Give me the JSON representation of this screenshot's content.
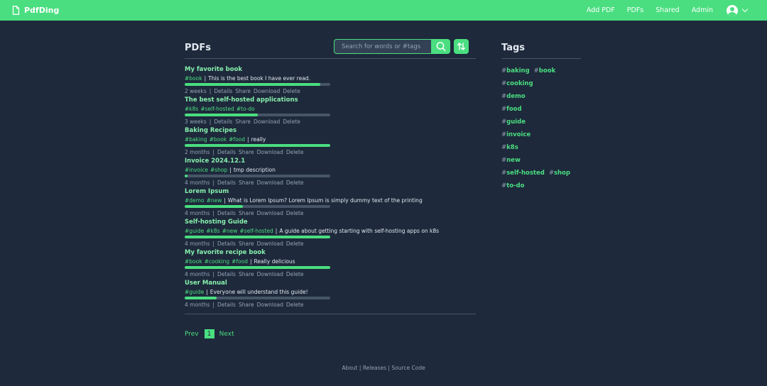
{
  "brand": {
    "name": "PdfDing"
  },
  "nav": {
    "add_pdf": "Add PDF",
    "pdfs": "PDFs",
    "shared": "Shared",
    "admin": "Admin"
  },
  "main": {
    "title": "PDFs",
    "search_placeholder": "Search for words or #tags"
  },
  "pdfs": [
    {
      "title": "My favorite book",
      "tags": [
        "#book"
      ],
      "description": "This is the best book I have ever read.",
      "progress": 0.93,
      "age": "2 weeks"
    },
    {
      "title": "The best self-hosted applications",
      "tags": [
        "#k8s",
        "#self-hosted",
        "#to-do"
      ],
      "description": "",
      "progress": 0.5,
      "age": "3 weeks"
    },
    {
      "title": "Baking Recipes",
      "tags": [
        "#baking",
        "#book",
        "#food"
      ],
      "description": "really",
      "progress": 1.0,
      "age": "2 months"
    },
    {
      "title": "Invoice 2024.12.1",
      "tags": [
        "#invoice",
        "#shop"
      ],
      "description": "tmp description",
      "progress": 0.02,
      "age": "4 months"
    },
    {
      "title": "Lorem Ipsum",
      "tags": [
        "#demo",
        "#new"
      ],
      "description": "What is Lorem Ipsum? Lorem Ipsum is simply dummy text of the printing",
      "progress": 0.4,
      "age": "4 months"
    },
    {
      "title": "Self-hosting Guide",
      "tags": [
        "#guide",
        "#k8s",
        "#new",
        "#self-hosted"
      ],
      "description": "A guide about getting starting with self-hosting apps on k8s",
      "progress": 1.0,
      "age": "4 months"
    },
    {
      "title": "My favorite recipe book",
      "tags": [
        "#book",
        "#cooking",
        "#food"
      ],
      "description": "Really delicious",
      "progress": 1.0,
      "age": "4 months"
    },
    {
      "title": "User Manual",
      "tags": [
        "#guide"
      ],
      "description": "Everyone will understand this guide!",
      "progress": 0.22,
      "age": "4 months"
    }
  ],
  "actions": {
    "details": "Details",
    "share": "Share",
    "download": "Download",
    "delete": "Delete"
  },
  "pagination": {
    "prev": "Prev",
    "current": "1",
    "next": "Next"
  },
  "sidebar": {
    "title": "Tags",
    "rows": [
      [
        "baking",
        "book"
      ],
      [
        "cooking"
      ],
      [
        "demo"
      ],
      [
        "food"
      ],
      [
        "guide"
      ],
      [
        "invoice"
      ],
      [
        "k8s"
      ],
      [
        "new"
      ],
      [
        "self-hosted",
        "shop"
      ],
      [
        "to-do"
      ]
    ]
  },
  "footer": {
    "about": "About",
    "releases": "Releases",
    "source_code": "Source Code",
    "separator": "|"
  },
  "colors": {
    "accent": "#4ade80",
    "background": "#1e293b",
    "title_green": "#86efac"
  },
  "icons": [
    "file-icon",
    "user-icon",
    "chevron-down-icon",
    "search-icon",
    "sort-icon"
  ]
}
